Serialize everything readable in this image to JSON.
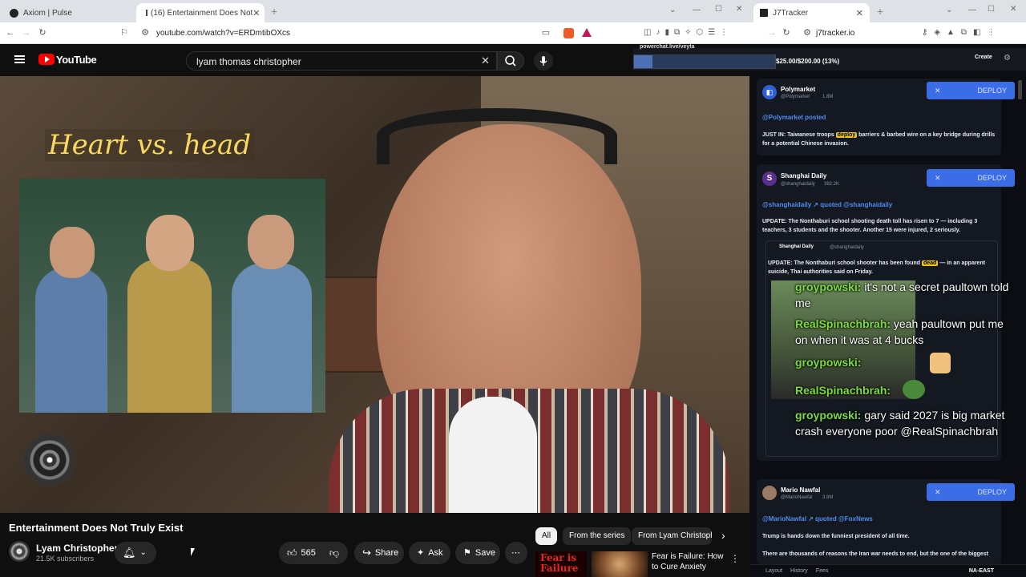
{
  "browser_left": {
    "tabs": [
      {
        "label": "Axiom | Pulse",
        "active": false
      },
      {
        "label": "(16) Entertainment Does Not",
        "active": true
      }
    ],
    "url": "youtube.com/watch?v=ERDmtibOXcs"
  },
  "browser_right": {
    "tab_label": "J7Tracker",
    "url": "j7tracker.io"
  },
  "youtube": {
    "logo_text": "YouTube",
    "search_value": "lyam thomas christopher",
    "video_overlay_title": "Heart vs. head",
    "video_title": "Entertainment Does Not Truly Exist",
    "channel_name": "Lyam Christopher",
    "subscribers": "21.5K subscribers",
    "likes": "565",
    "share_label": "Share",
    "ask_label": "Ask",
    "save_label": "Save",
    "chips": [
      "All",
      "From the series",
      "From Lyam Christophe"
    ],
    "rec_thumb_text": "Fear is Failure",
    "rec_title": "Fear is Failure: How to Cure Anxiety"
  },
  "tracker": {
    "progress_text": "$25.00/$200.00 (13%)",
    "progress_fraction": 0.13,
    "stream_url": "powerchat.live/veyta",
    "create_label": "Create",
    "deploy_label": "DEPLOY",
    "posts": [
      {
        "name": "Polymarket",
        "handle": "@Polymarket",
        "followers": "1.8M",
        "action": "@Polymarket posted",
        "text_pre": "JUST IN: Taiwanese troops ",
        "highlight": "deploy",
        "text_post": " barriers & barbed wire on a key bridge during drills for a potential Chinese invasion."
      },
      {
        "name": "Shanghai Daily",
        "handle": "@shanghaidaily",
        "followers": "392.2K",
        "action": "@shanghaidaily ↗ quoted @shanghaidaily",
        "text": "UPDATE: The Nonthaburi school shooting death toll has risen to 7 — including 3 teachers, 3 students and the shooter. Another 15 were injured, 2 seriously.",
        "quote_name": "Shanghai Daily",
        "quote_handle": "@shanghaidaily",
        "quote_pre": "UPDATE: The Nonthaburi school shooter has been found ",
        "quote_highlight": "dead",
        "quote_post": " — in an apparent suicide, Thai authorities said on Friday."
      },
      {
        "name": "Mario Nawfal",
        "handle": "@MarioNawfal",
        "followers": "3.8M",
        "action": "@MarioNawfal ↗ quoted @FoxNews",
        "text": "Trump is hands down the funniest president of all time.",
        "text2": "There are thousands of reasons the Iran war needs to end, but the one of the biggest"
      }
    ],
    "chat": [
      {
        "user": "groypowski:",
        "msg": "it's not a secret paultown told me"
      },
      {
        "user": "RealSpinachbrah:",
        "msg": "yeah paultown put me on when it was at 4 bucks"
      },
      {
        "user": "groypowski:",
        "msg": ""
      },
      {
        "user": "RealSpinachbrah:",
        "msg": ""
      },
      {
        "user": "groypowski:",
        "msg": "gary said 2027 is big market crash everyone poor @RealSpinachbrah"
      }
    ],
    "bottom_items": [
      "Layout",
      "History",
      "Fees",
      "NA-EAST"
    ]
  }
}
